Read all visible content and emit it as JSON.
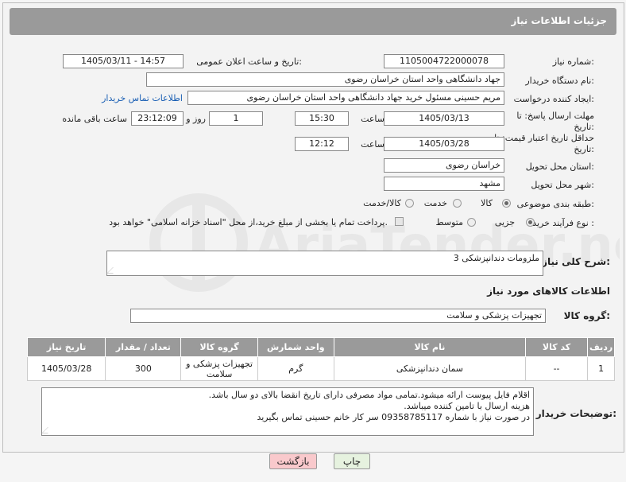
{
  "header": {
    "title": "جزئیات اطلاعات نیاز"
  },
  "labels": {
    "need_number": "شماره نیاز:",
    "announce_datetime": "تاریخ و ساعت اعلان عمومی:",
    "buyer_org": "نام دستگاه خریدار:",
    "requester": "ایجاد کننده درخواست:",
    "buyer_contact_link": "اطلاعات تماس خریدار",
    "response_deadline": "مهلت ارسال پاسخ: تا تاریخ:",
    "time_word": "ساعت",
    "day_and": "روز و",
    "remaining": "ساعت باقی مانده",
    "price_validity": "حداقل تاریخ اعتبار قیمت: تا تاریخ:",
    "province": "استان محل تحویل:",
    "city": "شهر محل تحویل:",
    "category": "طبقه بندی موضوعی:",
    "purchase_type": "نوع فرآیند خرید :",
    "summary": "شرح کلی نیاز:",
    "goods_info": "اطلاعات کالاهای مورد نیاز",
    "goods_group": "گروه کالا:",
    "buyer_notes": "توضیحات خریدار:"
  },
  "values": {
    "need_number": "1105004722000078",
    "announce_datetime": "1405/03/11 - 14:57",
    "buyer_org": "جهاد دانشگاهی واحد استان خراسان رضوی",
    "requester": "مریم حسینی مسئول خرید جهاد دانشگاهی واحد استان خراسان رضوی",
    "response_date": "1405/03/13",
    "response_time": "15:30",
    "response_days": "1",
    "response_remaining": "23:12:09",
    "price_date": "1405/03/28",
    "price_time": "12:12",
    "province": "خراسان رضوی",
    "city": "مشهد",
    "summary": "ملزومات دندانپزشکی 3",
    "goods_group": "تجهیزات پزشکی و سلامت",
    "buyer_notes": [
      "اقلام فایل پیوست ارائه میشود.تمامی مواد مصرفی دارای تاریخ انقضا بالای دو سال باشد.",
      "هزینه ارسال با تامین کننده میباشد.",
      "در صورت نیاز با شماره 09358785117  سر کار خانم حسینی تماس بگیرید"
    ]
  },
  "category_options": {
    "goods": "کالا",
    "service": "خدمت",
    "goods_service": "کالا/خدمت",
    "selected": "کالا"
  },
  "purchase_options": {
    "partial": "جزیی",
    "medium": "متوسط",
    "selected": "جزیی"
  },
  "payment_note": "پرداخت تمام یا بخشی از مبلغ خرید،از محل \"اسناد خزانه اسلامی\" خواهد بود.",
  "table": {
    "headers": [
      "ردیف",
      "کد کالا",
      "نام کالا",
      "واحد شمارش",
      "گروه کالا",
      "تعداد / مقدار",
      "تاریخ نیاز"
    ],
    "rows": [
      [
        "1",
        "--",
        "سمان دندانپزشکی",
        "گرم",
        "تجهیزات پزشکی و سلامت",
        "300",
        "1405/03/28"
      ]
    ]
  },
  "buttons": {
    "back": "بازگشت",
    "print": "چاپ"
  },
  "watermark": {
    "text": "AriaTender.net"
  },
  "colors": {
    "header_bg": "#9a9a9a",
    "link": "#1a5fb4",
    "back_btn": "#f9c9cc",
    "print_btn": "#e6f2df"
  }
}
